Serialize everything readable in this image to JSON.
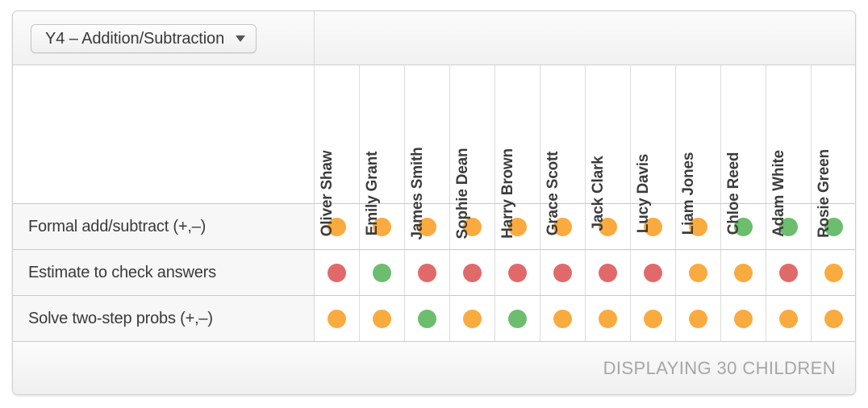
{
  "toolbar": {
    "unit_select_label": "Y4 – Addition/Subtraction",
    "caret_icon": "chevron-down-icon"
  },
  "grid": {
    "pupils": [
      "Oliver Shaw",
      "Emily Grant",
      "James Smith",
      "Sophie Dean",
      "Harry Brown",
      "Grace Scott",
      "Jack Clark",
      "Lucy Davis",
      "Liam Jones",
      "Chloe Reed",
      "Adam White",
      "Rosie Green"
    ],
    "objectives": [
      {
        "label": "Formal add/subtract (+,–)",
        "ratings": [
          "amber",
          "amber",
          "amber",
          "amber",
          "amber",
          "amber",
          "amber",
          "amber",
          "amber",
          "green",
          "green",
          "green"
        ]
      },
      {
        "label": "Estimate to check answers",
        "ratings": [
          "red",
          "green",
          "red",
          "red",
          "red",
          "red",
          "red",
          "red",
          "amber",
          "amber",
          "red",
          "amber"
        ]
      },
      {
        "label": "Solve two-step probs (+,–)",
        "ratings": [
          "amber",
          "amber",
          "green",
          "amber",
          "green",
          "amber",
          "amber",
          "amber",
          "amber",
          "amber",
          "amber",
          "amber"
        ]
      }
    ]
  },
  "footer": {
    "count_text": "DISPLAYING 30 CHILDREN"
  },
  "colors": {
    "red": "#e06a6a",
    "amber": "#f9ab3f",
    "green": "#6cbd6e"
  }
}
